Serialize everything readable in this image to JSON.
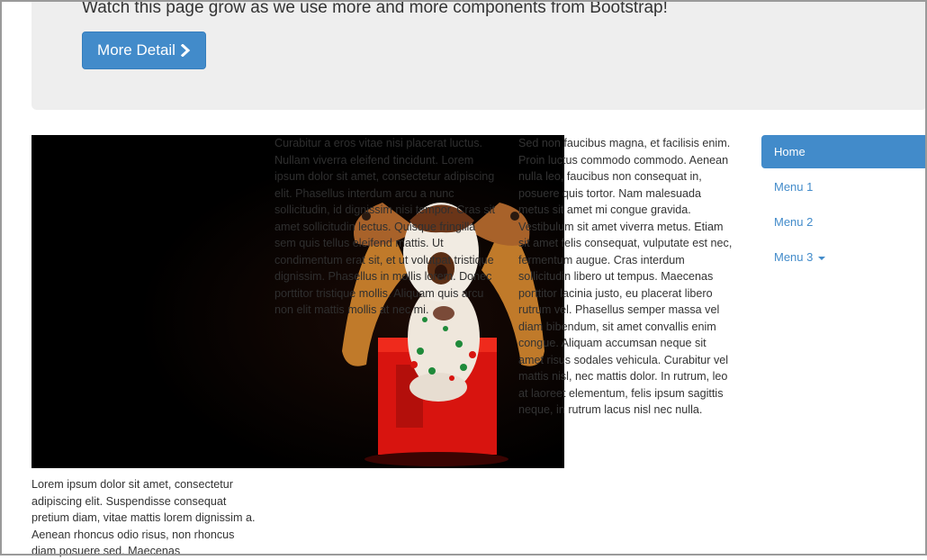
{
  "jumbotron": {
    "text": "Watch this page grow as we use more and more components from Bootstrap!",
    "button_label": "More Detail",
    "button_icon": "chevron-right-icon"
  },
  "colors": {
    "primary": "#428bca",
    "jumbotron_bg": "#eeeeee",
    "text": "#333333"
  },
  "columns": {
    "col1": "Curabitur a eros vitae nisi placerat luctus. Nullam viverra eleifend tincidunt. Lorem ipsum dolor sit amet, consectetur adipiscing elit. Phasellus interdum arcu a nunc sollicitudin, id dignissim nisi tempor. Cras sit amet sollicitudin lectus. Quisque fringilla sem quis tellus eleifend mattis. Ut condimentum erat sit, et ut volutpat tristique dignissim. Phasellus in mollis lorem. Donec porttitor tristique mollis. Aliquam quis arcu non elit mattis mollis at nec mi.",
    "col2": "Sed non faucibus magna, et facilisis enim. Proin luctus commodo commodo. Aenean nulla leo, faucibus non consequat in, posuere quis tortor. Nam malesuada metus sit amet mi congue gravida. Vestibulum sit amet viverra metus. Etiam sit amet felis consequat, vulputate est nec, fermentum augue. Cras interdum sollicitudin libero ut tempus. Maecenas porttitor lacinia justo, eu placerat libero rutrum vel. Phasellus semper massa vel diam bibendum, sit amet convallis enim congue. Aliquam accumsan neque sit amet risus sodales vehicula. Curabitur vel mattis nisl, nec mattis dolor. In rutrum, leo at laoreet elementum, felis ipsum sagittis neque, in rutrum lacus nisl nec nulla.",
    "col3": "Lorem ipsum dolor sit amet, consectetur adipiscing elit. Suspendisse consequat pretium diam, vitae mattis lorem dignissim a. Aenean rhoncus odio risus, non rhoncus diam posuere sed. Maecenas"
  },
  "nav": {
    "items": [
      {
        "label": "Home"
      },
      {
        "label": "Menu 1"
      },
      {
        "label": "Menu 2"
      },
      {
        "label": "Menu 3"
      }
    ]
  }
}
